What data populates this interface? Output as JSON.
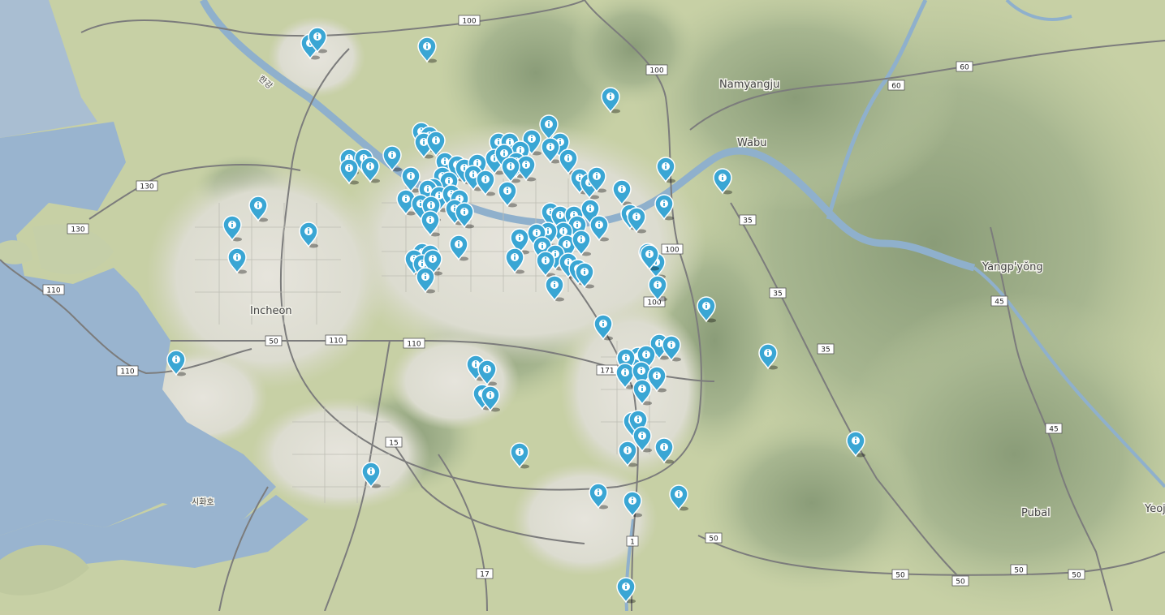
{
  "map": {
    "labels": [
      {
        "id": "incheon",
        "text": "Incheon"
      },
      {
        "id": "namyangju",
        "text": "Namyangju"
      },
      {
        "id": "wabu",
        "text": "Wabu"
      },
      {
        "id": "yangpyeong",
        "text": "Yangp'yŏng"
      },
      {
        "id": "pubal",
        "text": "Pubal"
      },
      {
        "id": "yeoju",
        "text": "Yeoju"
      },
      {
        "id": "sihwaho",
        "text": "시화호"
      },
      {
        "id": "hangang",
        "text": "한강"
      }
    ],
    "road_shields": [
      "100",
      "100",
      "100",
      "100",
      "60",
      "60",
      "130",
      "130",
      "110",
      "110",
      "110",
      "110",
      "50",
      "35",
      "35",
      "35",
      "45",
      "45",
      "171",
      "15",
      "17",
      "1",
      "50",
      "50",
      "50",
      "50",
      "50"
    ],
    "marker_icon": "info-marker-icon",
    "marker_color": "#3aa6d4",
    "marker_count": 120
  }
}
